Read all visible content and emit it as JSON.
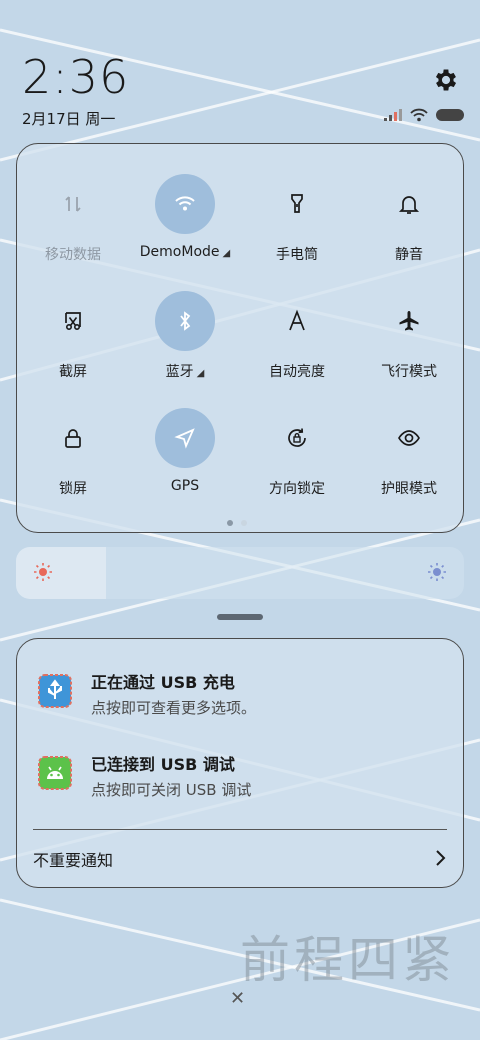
{
  "status_bar": {
    "time": "2:36",
    "date": "2月17日 周一"
  },
  "quick_tiles": [
    {
      "label": "移动数据",
      "icon": "mobile-data-icon",
      "active": false
    },
    {
      "label": "DemoMode",
      "icon": "wifi-icon",
      "active": true
    },
    {
      "label": "手电筒",
      "icon": "flashlight-icon",
      "active": false
    },
    {
      "label": "静音",
      "icon": "bell-icon",
      "active": false
    },
    {
      "label": "截屏",
      "icon": "screenshot-icon",
      "active": false
    },
    {
      "label": "蓝牙",
      "icon": "bluetooth-icon",
      "active": true
    },
    {
      "label": "自动亮度",
      "icon": "auto-brightness-icon",
      "active": false
    },
    {
      "label": "飞行模式",
      "icon": "airplane-icon",
      "active": false
    },
    {
      "label": "锁屏",
      "icon": "lock-icon",
      "active": false
    },
    {
      "label": "GPS",
      "icon": "location-arrow-icon",
      "active": true
    },
    {
      "label": "方向锁定",
      "icon": "rotation-lock-icon",
      "active": false
    },
    {
      "label": "护眼模式",
      "icon": "eye-icon",
      "active": false
    }
  ],
  "brightness": {
    "level": 0.2
  },
  "notifications": [
    {
      "title": "正在通过 USB 充电",
      "text": "点按即可查看更多选项。",
      "icon": "usb-icon"
    },
    {
      "title": "已连接到 USB 调试",
      "text": "点按即可关闭 USB 调试",
      "icon": "android-icon"
    }
  ],
  "unimportant_label": "不重要通知",
  "watermark": "前程四紧",
  "colors": {
    "background": "#c3d7e8",
    "tile_active": "#9fbedc"
  }
}
